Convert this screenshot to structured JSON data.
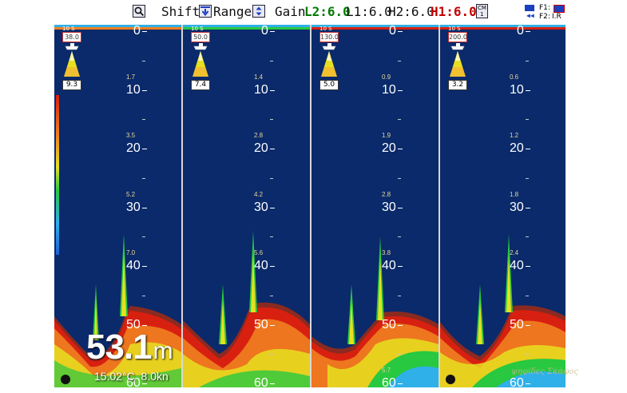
{
  "toolbar": {
    "zoom_icon": "magnifier-icon",
    "shift_label": "Shift:",
    "shift_icon": "shift-down-arrow-icon",
    "range_label": "Range:",
    "range_icon": "range-updown-icon",
    "gain_label": "Gain",
    "gain_l2": "L2:6.0",
    "gain_l1": "L1:6.0",
    "gain_h2": "H2:6.0",
    "gain_h1": "H1:6.0",
    "mode_icon": "cm-mode-icon",
    "mode_label_top": "CM",
    "mode_label_bottom": "1",
    "f1_label": "F1:",
    "f2_label": "F2:",
    "f2_value": "I.R",
    "colors": {
      "l2": "#007a00",
      "h1": "#c00000"
    }
  },
  "panels": [
    {
      "freq": "10 S",
      "range": "38.0",
      "value": "9.3",
      "subs": [
        "1.7",
        "3.5",
        "5.2",
        "7.0",
        "",
        ""
      ]
    },
    {
      "freq": "10 S",
      "range": "50.0",
      "value": "7.4",
      "subs": [
        "1.4",
        "2.8",
        "4.2",
        "5.6",
        "",
        ""
      ]
    },
    {
      "freq": "10 S",
      "range": "130.0",
      "value": "5.0",
      "subs": [
        "0.9",
        "1.9",
        "2.8",
        "3.8",
        "",
        "5.7"
      ]
    },
    {
      "freq": "10 S",
      "range": "200.0",
      "value": "3.2",
      "subs": [
        "0.6",
        "1.2",
        "1.8",
        "2.4",
        "",
        ""
      ]
    }
  ],
  "depth_scale": [
    "0",
    "10",
    "20",
    "30",
    "40",
    "50",
    "60"
  ],
  "readout": {
    "depth_value": "53.1",
    "depth_unit": "m",
    "temperature": "15.02°C",
    "speed": "8.0kn"
  },
  "watermark": "ψηφίδες Σκάφος",
  "echo_colors": [
    "#0a2a6b",
    "#1f5fd6",
    "#2fb0e8",
    "#28c840",
    "#e6e020",
    "#f08020",
    "#d82010",
    "#8a2a20"
  ]
}
